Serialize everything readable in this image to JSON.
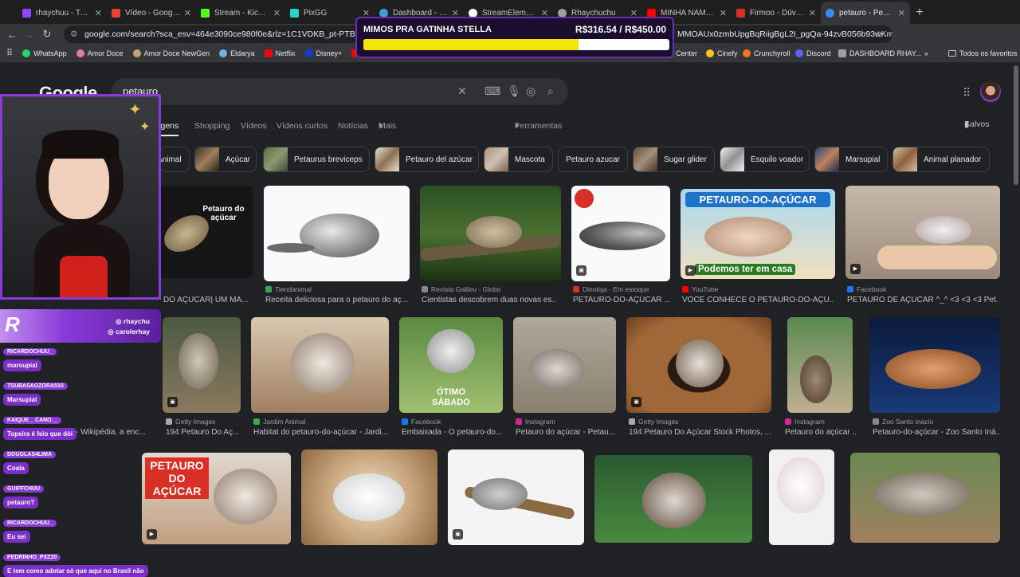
{
  "tabs": [
    {
      "label": "rhaychuu - Twitch",
      "color": "#9146ff"
    },
    {
      "label": "Vídeo - Google F",
      "color": "#ea4335"
    },
    {
      "label": "Stream - Kick Das",
      "color": "#53fc18"
    },
    {
      "label": "PixGG",
      "color": "#2ad4c4"
    },
    {
      "label": "Dashboard - Live",
      "color": "#3aa0e0"
    },
    {
      "label": "StreamElements",
      "color": "#ffffff"
    },
    {
      "label": "Rhaychuchu",
      "color": "#9aa0a6"
    },
    {
      "label": "MINHA NAMORA",
      "color": "#ff0000"
    },
    {
      "label": "Firmoo - Dúvida",
      "color": "#d93025"
    },
    {
      "label": "petauro - Pesquisa",
      "color": "#4285f4",
      "active": true
    }
  ],
  "address": {
    "url": "google.com/search?sca_esv=464e3090ce980f0e&rlz=1C1VDKB_pt-PTBR1166BR11",
    "url_suffix": "MMOAUx0zmbUpgBqRiigBgL2I_pgQa-94zvB056b93wKm..."
  },
  "bookmarks": [
    "WhatsApp",
    "Amor Doce",
    "Amor Doce NewGen",
    "Eldarya",
    "Netflix",
    "Disney+",
    "Yo"
  ],
  "bookmarks_right": [
    "Center",
    "Cinefy",
    "Crunchyroll",
    "Discord",
    "DASHBOARD RHAY..."
  ],
  "bookmarks_all": "Todos os favoritos",
  "google": {
    "logo": "Google",
    "query": "petauro",
    "tabs": [
      "Imagens",
      "Shopping",
      "Vídeos",
      "Vídeos curtos",
      "Notícias",
      "Mais"
    ],
    "tools": "Ferramentas",
    "saved": "Salvos"
  },
  "chips": [
    "Animal",
    "Açúcar",
    "Petaurus breviceps",
    "Petauro del azúcar",
    "Mascota",
    "Petauro azucar",
    "Sugar glider",
    "Esquilo voador",
    "Marsupial",
    "Animal planador"
  ],
  "results": [
    {
      "source": "",
      "caption": "DO AÇÚCAR| UM MA...",
      "label": "Petauro do açúcar"
    },
    {
      "source": "Tiendanimal",
      "caption": "Receita deliciosa para o petauro do aç..."
    },
    {
      "source": "Revista Galileu - Globo",
      "caption": "Cientistas descobrem duas novas es..."
    },
    {
      "source": "Dinoloja · Em estoque",
      "caption": "PETAURO-DO-AÇÚCAR ..."
    },
    {
      "source": "YouTube",
      "caption": "VOCÊ CONHECE O PETAURO-DO-AÇÚ...",
      "banner": "PETAURO-DO-AÇÚCAR",
      "sub": "Podemos ter em casa"
    },
    {
      "source": "Facebook",
      "caption": "PETAURO DE AÇÚCAR ^_^ <3 <3 <3 Pet..."
    },
    {
      "source": "",
      "caption": "- Wikipédia, a enc..."
    },
    {
      "source": "Getty Images",
      "caption": "194 Petauro Do Aç..."
    },
    {
      "source": "Jardim Animal",
      "caption": "Habitat do petauro-do-açúcar - Jardi..."
    },
    {
      "source": "Facebook",
      "caption": "Embaixada - O petauro-do...",
      "overlay": "ÓTIMO SÁBADO"
    },
    {
      "source": "Instagram",
      "caption": "Petauro do açúcar - Petau..."
    },
    {
      "source": "Getty Images",
      "caption": "194 Petauro Do Açúcar Stock Photos, ..."
    },
    {
      "source": "Instagram",
      "caption": "Petauro do açúcar ..."
    },
    {
      "source": "Zoo Santo Inácio",
      "caption": "Petauro-do-açúcar - Zoo Santo Iná..."
    },
    {
      "label2": "PETAURO DO AÇÚCAR"
    }
  ],
  "stream_overlay": {
    "goal_title": "MIMOS PRA GATINHA STELLA",
    "goal_amount": "R$316.54 / R$450.00",
    "goal_progress": 0.703,
    "social_1": "rhaychu",
    "social_2": "carolerhay"
  },
  "chat": [
    {
      "user": "RICARDOCHUU_",
      "text": "marsupial"
    },
    {
      "user": "TSUBASAOZORA510",
      "text": "Marsupial"
    },
    {
      "user": "KAIQUE__CANO__",
      "text": "Topeira é feio que dói"
    },
    {
      "user": "DOUGLAS4LIMA",
      "text": "Coala"
    },
    {
      "user": "GUIFFCHUU",
      "text": "petauro?"
    },
    {
      "user": "RICARDOCHUU_",
      "text": "Eu sei"
    },
    {
      "user": "PEDRINHO_PXZ20",
      "text": "E tem como adotar só que aqui no Brasil não"
    }
  ]
}
